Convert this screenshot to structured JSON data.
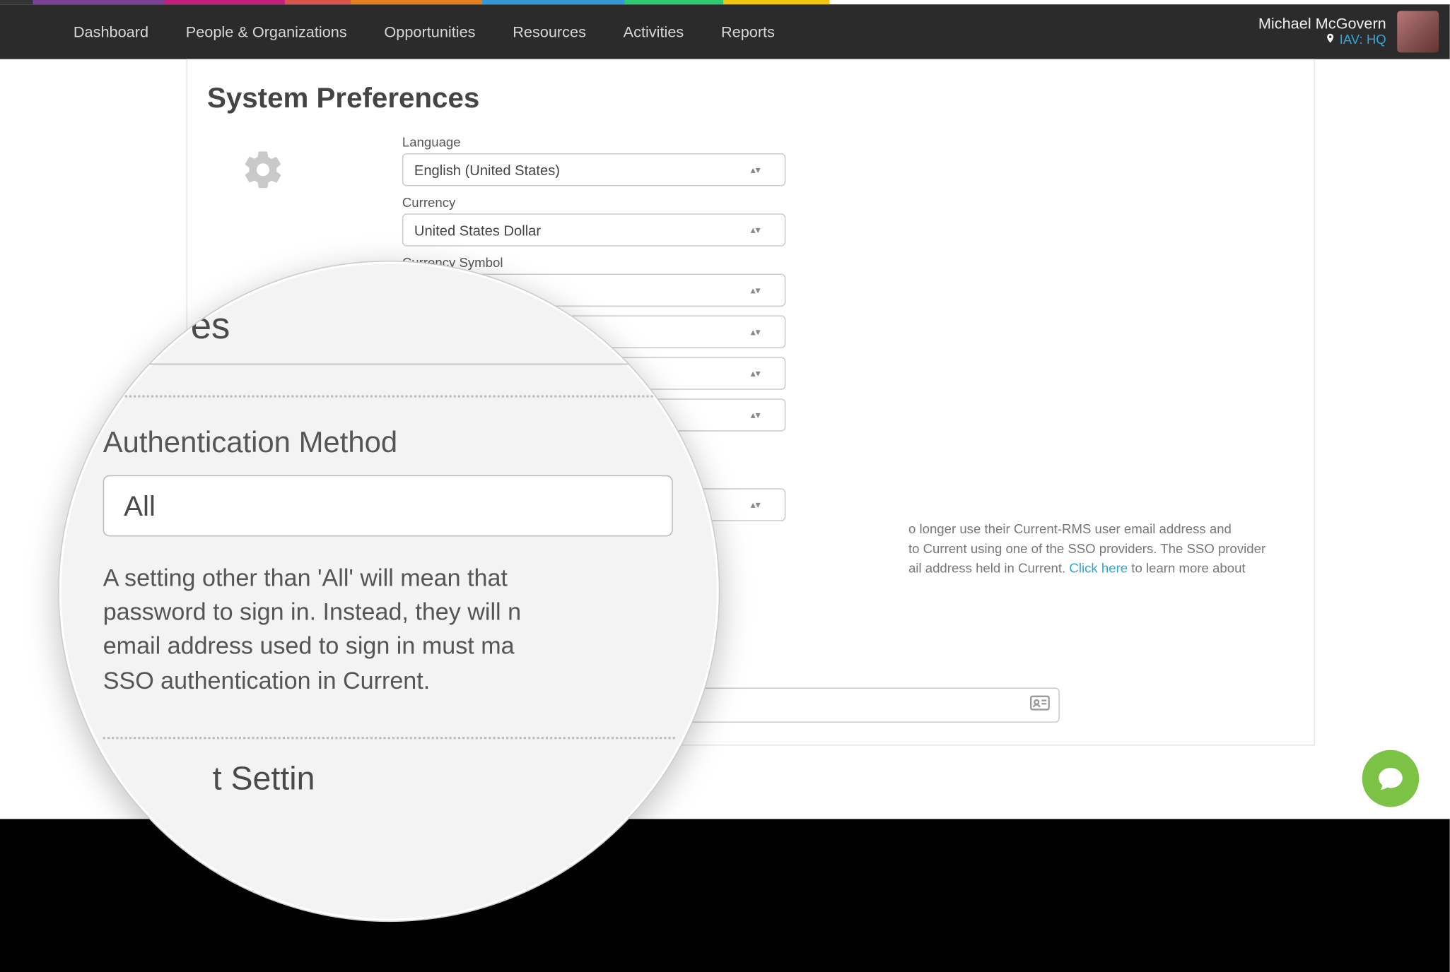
{
  "nav": {
    "items": [
      "Dashboard",
      "People & Organizations",
      "Opportunities",
      "Resources",
      "Activities",
      "Reports"
    ]
  },
  "user": {
    "name": "Michael McGovern",
    "location": "IAV: HQ"
  },
  "page": {
    "title": "System Preferences",
    "fields": {
      "language": {
        "label": "Language",
        "value": "English (United States)"
      },
      "currency": {
        "label": "Currency",
        "value": "United States Dollar"
      },
      "currency_symbol": {
        "label": "Currency Symbol",
        "value": ""
      }
    },
    "help": {
      "part1": "o longer use their Current-RMS user email address and ",
      "part2": "to Current using one of the SSO providers. The SSO provider ",
      "part3": "ail address held in Current. ",
      "link": "Click here",
      "part4": " to learn more about"
    }
  },
  "magnifier": {
    "es_fragment": "es",
    "title": "Authentication Method",
    "value": "All",
    "desc_l1": "A setting other than 'All' will mean that",
    "desc_l2": "password to sign in. Instead, they will n",
    "desc_l3": "email address used to sign in must ma",
    "desc_l4": "SSO authentication in Current.",
    "footer_fragment": "t Settin"
  }
}
